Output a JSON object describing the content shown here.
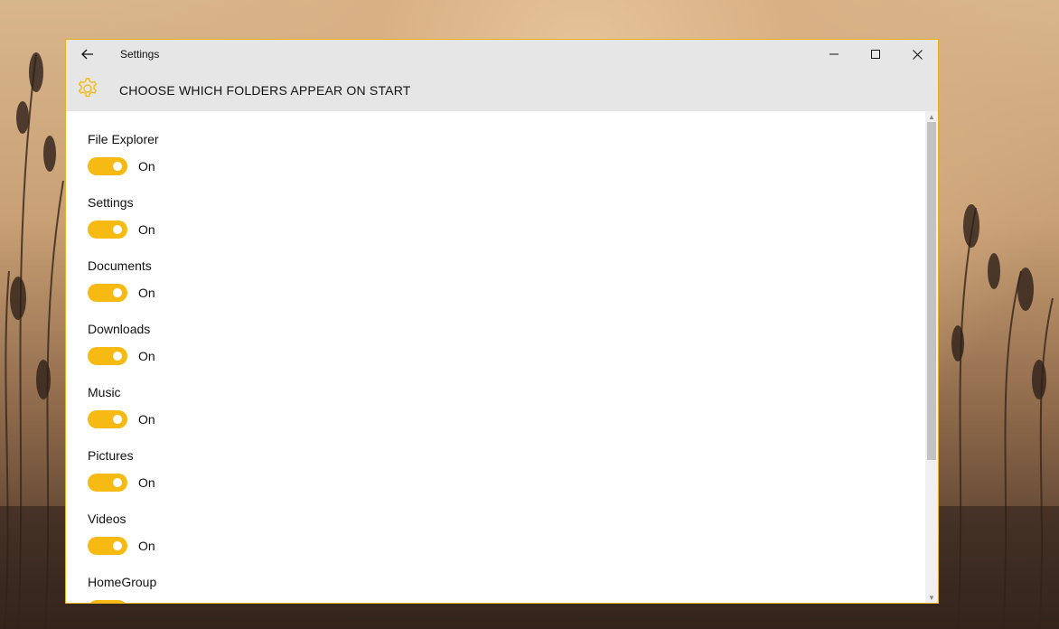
{
  "window": {
    "title": "Settings",
    "accent": "#f6ba12"
  },
  "header": {
    "icon": "gear-icon",
    "title": "CHOOSE WHICH FOLDERS APPEAR ON START"
  },
  "folders": [
    {
      "label": "File Explorer",
      "state": "On"
    },
    {
      "label": "Settings",
      "state": "On"
    },
    {
      "label": "Documents",
      "state": "On"
    },
    {
      "label": "Downloads",
      "state": "On"
    },
    {
      "label": "Music",
      "state": "On"
    },
    {
      "label": "Pictures",
      "state": "On"
    },
    {
      "label": "Videos",
      "state": "On"
    },
    {
      "label": "HomeGroup",
      "state": "On"
    }
  ]
}
